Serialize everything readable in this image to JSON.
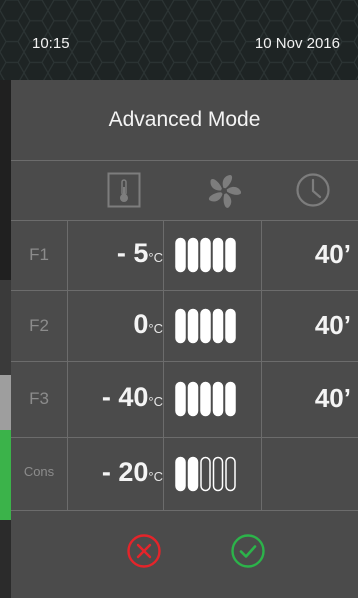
{
  "status": {
    "time": "10:15",
    "date": "10  Nov  2016"
  },
  "title": "Advanced Mode",
  "header_icons": {
    "temperature": "thermometer-icon",
    "fan": "fan-icon",
    "time": "clock-icon"
  },
  "unit": "°C",
  "rows": [
    {
      "label": "F1",
      "sign": "- ",
      "value": "5",
      "fan_level": 5,
      "time": "40’"
    },
    {
      "label": "F2",
      "sign": "",
      "value": "0",
      "fan_level": 5,
      "time": "40’"
    },
    {
      "label": "F3",
      "sign": "- ",
      "value": "40",
      "fan_level": 5,
      "time": "40’"
    },
    {
      "label": "Cons",
      "sign": "- ",
      "value": "20",
      "fan_level": 2,
      "time": ""
    }
  ],
  "fan_max": 5,
  "actions": {
    "cancel": "cancel-icon",
    "confirm": "confirm-icon"
  },
  "colors": {
    "cancel": "#e5242a",
    "confirm": "#2cb34a",
    "accent_green": "#3bb34a"
  }
}
